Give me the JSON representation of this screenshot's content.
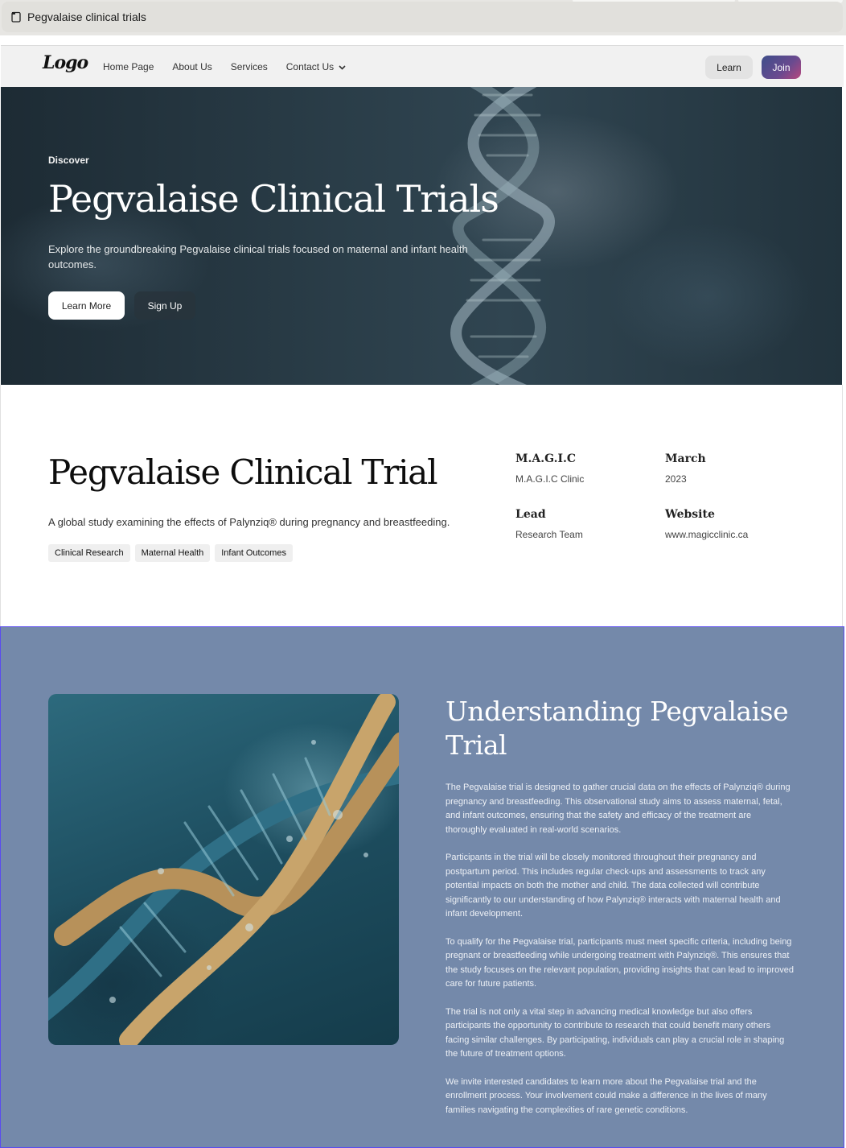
{
  "browser": {
    "tab_title": "Pegvalaise clinical trials",
    "tab_icon": "clipboard-icon"
  },
  "nav": {
    "logo": "Logo",
    "links": [
      {
        "label": "Home Page"
      },
      {
        "label": "About Us"
      },
      {
        "label": "Services"
      },
      {
        "label": "Contact Us",
        "icon": "chevron-down-icon"
      }
    ],
    "learn_label": "Learn",
    "join_label": "Join"
  },
  "hero": {
    "kicker": "Discover",
    "title": "Pegvalaise Clinical Trials",
    "description": "Explore the groundbreaking Pegvalaise clinical trials focused on maternal and infant health outcomes.",
    "primary_button": "Learn More",
    "secondary_button": "Sign Up"
  },
  "info": {
    "title": "Pegvalaise Clinical Trial",
    "subtitle": "A global study examining the effects of Palynziq® during pregnancy and breastfeeding.",
    "tags": [
      "Clinical Research",
      "Maternal Health",
      "Infant Outcomes"
    ],
    "meta": [
      {
        "heading": "M.A.G.I.C",
        "value": "M.A.G.I.C Clinic"
      },
      {
        "heading": "March",
        "value": "2023"
      },
      {
        "heading": "Lead",
        "value": "Research Team"
      },
      {
        "heading": "Website",
        "value": "www.magicclinic.ca"
      }
    ]
  },
  "understanding": {
    "title": "Understanding Pegvalaise Trial",
    "paragraphs": [
      "The Pegvalaise trial is designed to gather crucial data on the effects of Palynziq® during pregnancy and breastfeeding. This observational study aims to assess maternal, fetal, and infant outcomes, ensuring that the safety and efficacy of the treatment are thoroughly evaluated in real-world scenarios.",
      "Participants in the trial will be closely monitored throughout their pregnancy and postpartum period. This includes regular check-ups and assessments to track any potential impacts on both the mother and child. The data collected will contribute significantly to our understanding of how Palynziq® interacts with maternal health and infant development.",
      "To qualify for the Pegvalaise trial, participants must meet specific criteria, including being pregnant or breastfeeding while undergoing treatment with Palynziq®. This ensures that the study focuses on the relevant population, providing insights that can lead to improved care for future patients.",
      "The trial is not only a vital step in advancing medical knowledge but also offers participants the opportunity to contribute to research that could benefit many others facing similar challenges. By participating, individuals can play a crucial role in shaping the future of treatment options.",
      "We invite interested candidates to learn more about the Pegvalaise trial and the enrollment process. Your involvement could make a difference in the lives of many families navigating the complexities of rare genetic conditions."
    ]
  },
  "colors": {
    "section_bg": "#7489aa",
    "join_gradient_start": "#3e4e8a",
    "join_gradient_end": "#b6477e"
  }
}
